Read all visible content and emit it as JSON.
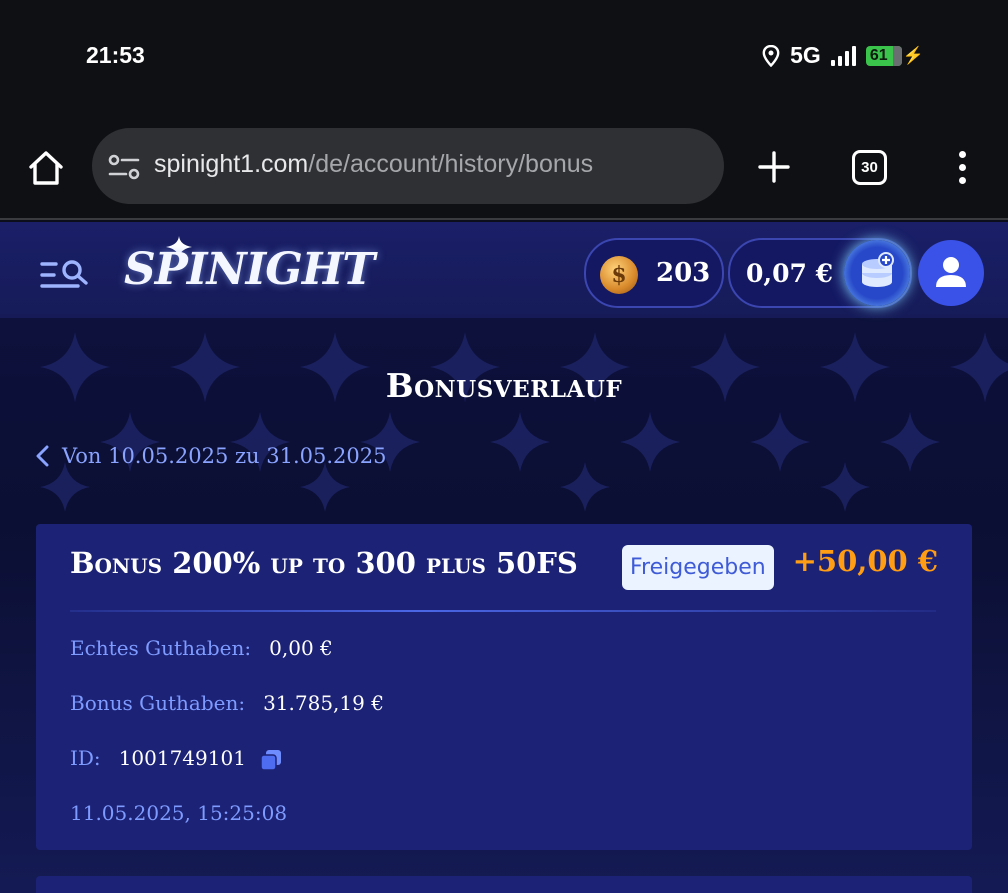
{
  "status_bar": {
    "time": "21:53",
    "network": "5G",
    "battery": "61"
  },
  "browser": {
    "url_domain": "spinight1.com",
    "url_path": "/de/account/history/bonus",
    "tab_count": "30"
  },
  "site": {
    "logo": "SPINIGHT",
    "coins": "203",
    "balance": "0,07 €",
    "coin_symbol": "$"
  },
  "page": {
    "title": "Bonusverlauf",
    "date_range": "Von 10.05.2025 zu 31.05.2025"
  },
  "bonus_card": {
    "title": "Bonus 200% up to 300 plus 50FS",
    "status": "Freigegeben",
    "amount": "+50,00 €",
    "real_balance_label": "Echtes Guthaben:",
    "real_balance_value": "0,00 €",
    "bonus_balance_label": "Bonus Guthaben:",
    "bonus_balance_value": "31.785,19 €",
    "id_label": "ID:",
    "id_value": "1001749101",
    "timestamp": "11.05.2025, 15:25:08"
  },
  "colors": {
    "accent_orange": "#ff9d14",
    "label_blue": "#7e9bff",
    "card_bg": "#1c2275",
    "badge_bg": "#eaf3ff"
  }
}
